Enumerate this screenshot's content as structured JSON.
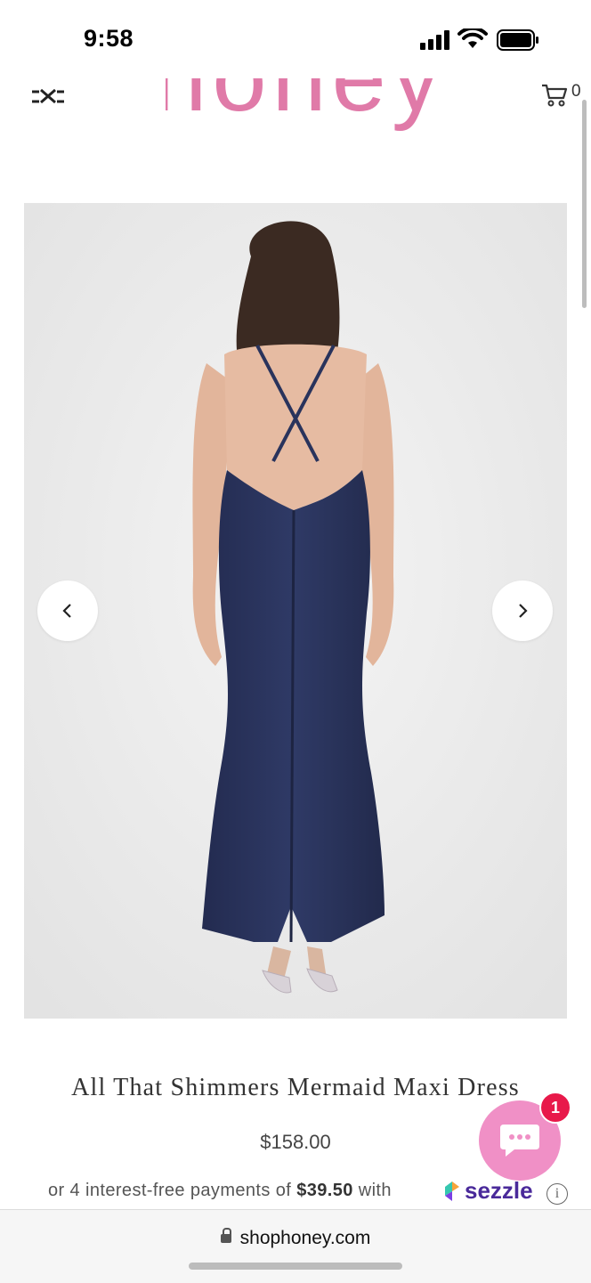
{
  "status_bar": {
    "time": "9:58"
  },
  "header": {
    "logo_text": "honey",
    "cart_count": "0"
  },
  "product": {
    "title": "All That Shimmers Mermaid Maxi Dress",
    "price": "$158.00",
    "installments": {
      "prefix": "or 4 interest-free payments of ",
      "amount": "$39.50",
      "suffix": " with",
      "provider": "sezzle"
    }
  },
  "gallery": {
    "prev_icon": "chevron-left-icon",
    "next_icon": "chevron-right-icon",
    "dress_color": "#29335c"
  },
  "chat": {
    "badge_count": "1"
  },
  "browser": {
    "url": "shophoney.com"
  },
  "colors": {
    "brand_pink": "#e07aa8",
    "chat_pink": "#f090c6",
    "badge_red": "#e8194a",
    "sezzle_purple": "#4a2a9a"
  }
}
